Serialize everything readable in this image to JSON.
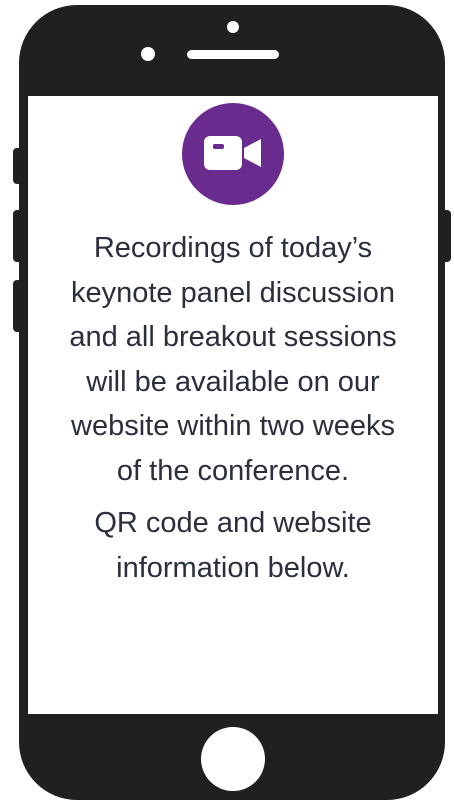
{
  "phone": {
    "body_color": "#221f20",
    "screen": {
      "badge": {
        "icon": "video-camera-icon",
        "color": "#6a2b8f"
      },
      "message": "Recordings of today’s keynote panel discussion and all breakout sessions will be available on our website within two weeks of the conference.",
      "note": "QR code and website information below."
    }
  }
}
